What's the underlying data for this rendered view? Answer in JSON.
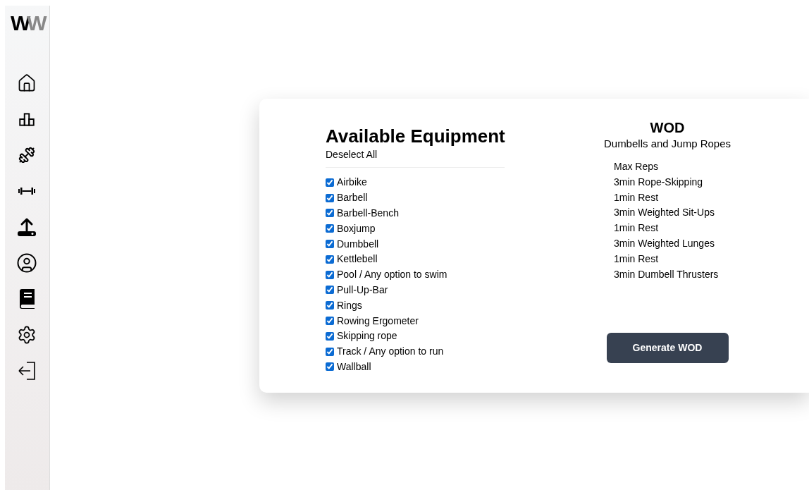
{
  "logo": {
    "letters": [
      "W",
      "W"
    ]
  },
  "equipment": {
    "title": "Available Equipment",
    "toggle_all": "Deselect All",
    "items": [
      {
        "label": "Airbike",
        "checked": true
      },
      {
        "label": "Barbell",
        "checked": true
      },
      {
        "label": "Barbell-Bench",
        "checked": true
      },
      {
        "label": "Boxjump",
        "checked": true
      },
      {
        "label": "Dumbbell",
        "checked": true
      },
      {
        "label": "Kettlebell",
        "checked": true
      },
      {
        "label": "Pool / Any option to swim",
        "checked": true
      },
      {
        "label": "Pull-Up-Bar",
        "checked": true
      },
      {
        "label": "Rings",
        "checked": true
      },
      {
        "label": "Rowing Ergometer",
        "checked": true
      },
      {
        "label": "Skipping rope",
        "checked": true
      },
      {
        "label": "Track / Any option to run",
        "checked": true
      },
      {
        "label": "Wallball",
        "checked": true
      }
    ]
  },
  "wod": {
    "title": "WOD",
    "subtitle": "Dumbells and Jump Ropes",
    "steps": [
      "Max Reps",
      "3min Rope-Skipping",
      "1min Rest",
      "3min Weighted Sit-Ups",
      "1min Rest",
      "3min Weighted Lunges",
      "1min Rest",
      "3min Dumbell Thrusters"
    ],
    "button": "Generate WOD"
  }
}
